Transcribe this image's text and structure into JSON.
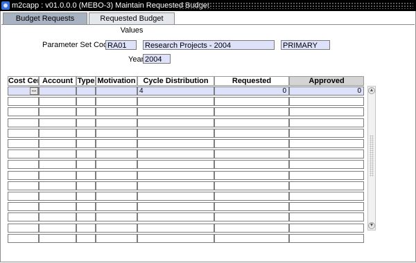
{
  "window": {
    "title": "m2capp : v01.0.0.0 (MEBO-3) Maintain Requested Budget"
  },
  "tabs": [
    {
      "label": "Budget Requests",
      "active": false
    },
    {
      "label": "Requested Budget Values",
      "active": true
    }
  ],
  "form": {
    "param_set_label": "Parameter Set Code",
    "param_set_code": "RA01",
    "param_set_desc": "Research Projects - 2004",
    "param_set_type": "PRIMARY",
    "year_label": "Year",
    "year": "2004"
  },
  "grid": {
    "headers": {
      "cost_centre": "Cost Cen",
      "account": "Account",
      "type": "Type",
      "motivation": "Motivation",
      "cycle_distribution": "Cycle Distribution",
      "requested": "Requested",
      "approved": "Approved"
    },
    "first_row": {
      "cycle_distribution": "4",
      "requested": "0",
      "approved": "0"
    },
    "lov_button_label": "...",
    "row_count": 15
  },
  "icons": {
    "app": "app-icon",
    "scroll_up": "scroll-up-icon",
    "scroll_down": "scroll-down-icon"
  }
}
